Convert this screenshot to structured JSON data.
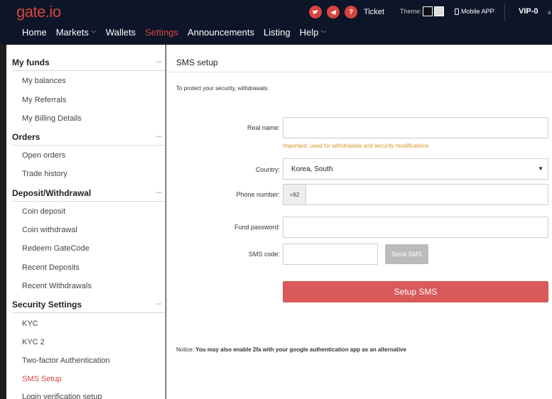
{
  "header": {
    "logo": "gate.io",
    "ticket_label": "Ticket",
    "theme_label": "Theme:",
    "mobile_app_label": "Mobile APP",
    "vip_label": "VIP-0",
    "vip_suffix": "a",
    "icon_glyphs": {
      "question": "?"
    }
  },
  "nav": {
    "items": [
      {
        "label": "Home"
      },
      {
        "label": "Markets"
      },
      {
        "label": "Wallets"
      },
      {
        "label": "Settings"
      },
      {
        "label": "Announcements"
      },
      {
        "label": "Listing"
      },
      {
        "label": "Help"
      }
    ],
    "active": "Settings"
  },
  "sidebar": {
    "collapse_glyph": "–",
    "sections": [
      {
        "title": "My funds",
        "items": [
          "My balances",
          "My Referrals",
          "My Billing Details"
        ]
      },
      {
        "title": "Orders",
        "items": [
          "Open orders",
          "Trade history"
        ]
      },
      {
        "title": "Deposit/Withdrawal",
        "items": [
          "Coin deposit",
          "Coin withdrawal",
          "Redeem GateCode",
          "Recent Deposits",
          "Recent Withdrawals"
        ]
      },
      {
        "title": "Security Settings",
        "items": [
          "KYC",
          "KYC 2",
          "Two-factor Authentication",
          "SMS Setup",
          "Login verification setup"
        ]
      }
    ],
    "active_item": "SMS Setup"
  },
  "main": {
    "title": "SMS setup",
    "intro": "To protect your security, withdrawals.",
    "form": {
      "real_name_label": "Real name:",
      "real_name_value": "",
      "real_name_hint": "Important, used for withdrawals and security modifications",
      "country_label": "Country:",
      "country_value": "Korea, South",
      "phone_label": "Phone number:",
      "phone_prefix": "+82",
      "phone_value": "",
      "fund_password_label": "Fund password:",
      "fund_password_value": "",
      "sms_code_label": "SMS code:",
      "sms_code_value": "",
      "send_sms_label": "Send SMS",
      "submit_label": "Setup SMS"
    },
    "notice_prefix": "Notice:",
    "notice_text": "You may also enable 2fa with your google authentication app as an alternative"
  },
  "colors": {
    "header_bg": "#0d1528",
    "accent": "#d6443f",
    "submit_bg": "#d95a5a",
    "hint": "#d79424",
    "send_sms_bg": "#bbbbbb"
  }
}
